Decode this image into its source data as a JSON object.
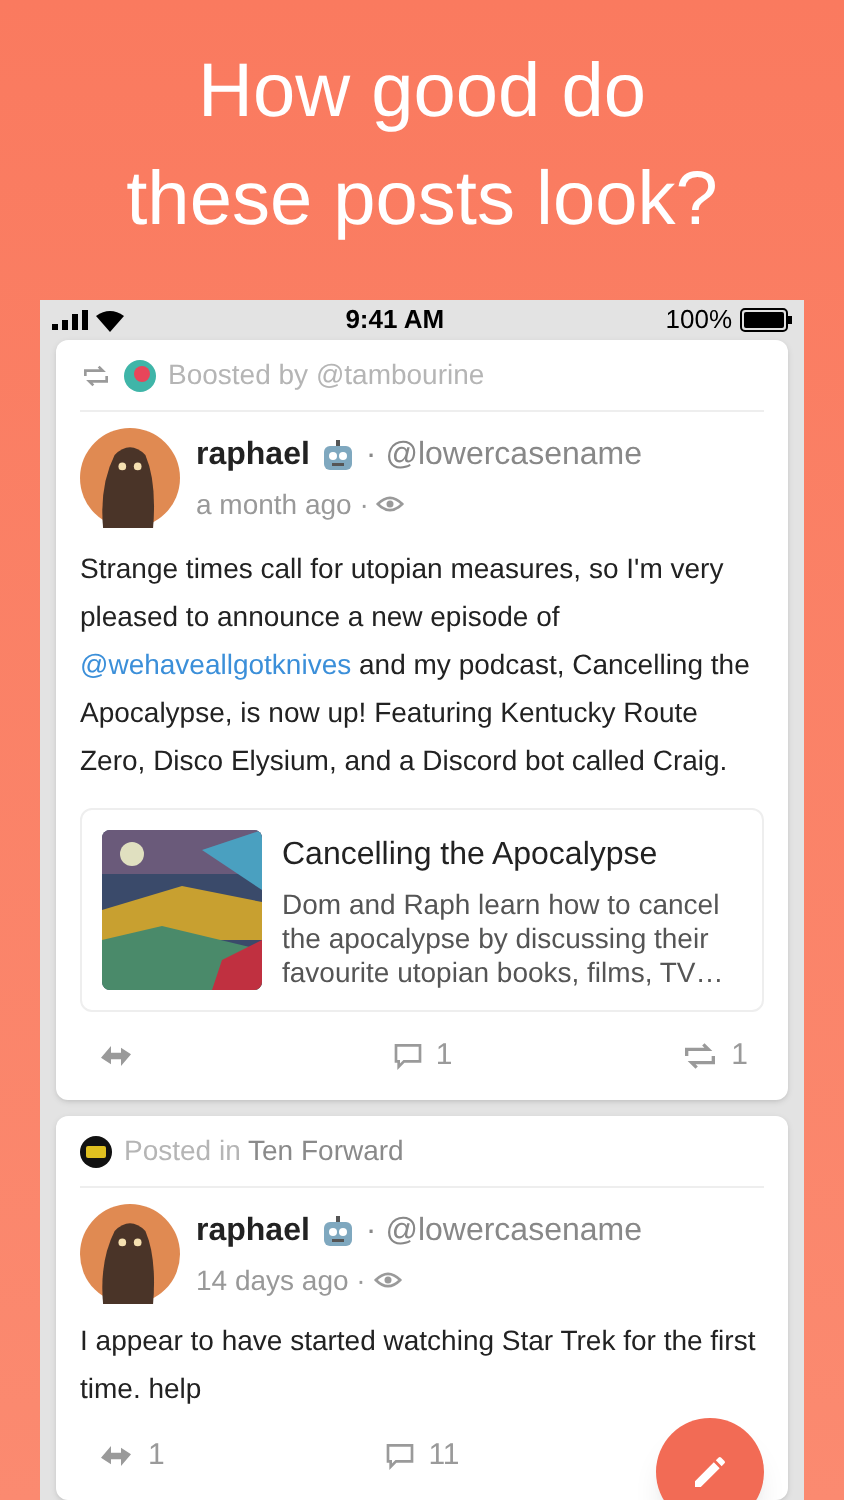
{
  "headline_lines": [
    "How good do",
    "these posts look?"
  ],
  "status_bar": {
    "time": "9:41 AM",
    "battery": "100%"
  },
  "posts": [
    {
      "context": {
        "kind": "boosted",
        "prefix": "Boosted by ",
        "name": "@tambourine"
      },
      "author": {
        "name": "raphael",
        "handle": "· @lowercasename",
        "time": "a month ago ·"
      },
      "body": [
        {
          "kind": "text",
          "text": "Strange times call for utopian measures, so I'm very pleased to announce a new episode of "
        },
        {
          "kind": "mention",
          "text": "@wehaveallgotknives"
        },
        {
          "kind": "text",
          "text": " and my podcast, Cancelling the Apocalypse, is now up! Featuring Kentucky Route Zero, Disco Elysium, and a Discord bot called Craig."
        }
      ],
      "link_card": {
        "title": "Cancelling the Apocalypse",
        "description": "Dom and Raph learn how to cancel the apocalypse by discussing their favourite utopian books, films, TV…"
      },
      "actions": [
        {
          "kind": "share"
        },
        {
          "kind": "comment",
          "count": "1"
        },
        {
          "kind": "boost",
          "count": "1"
        }
      ]
    },
    {
      "context": {
        "kind": "community",
        "prefix": "Posted in ",
        "name": "Ten Forward"
      },
      "author": {
        "name": "raphael",
        "handle": "· @lowercasename",
        "time": "14 days ago ·"
      },
      "body": [
        {
          "kind": "text",
          "text": "I appear to have started watching Star Trek for the first time. help"
        }
      ],
      "actions": [
        {
          "kind": "share",
          "count": "1"
        },
        {
          "kind": "comment",
          "count": "11"
        }
      ]
    }
  ]
}
